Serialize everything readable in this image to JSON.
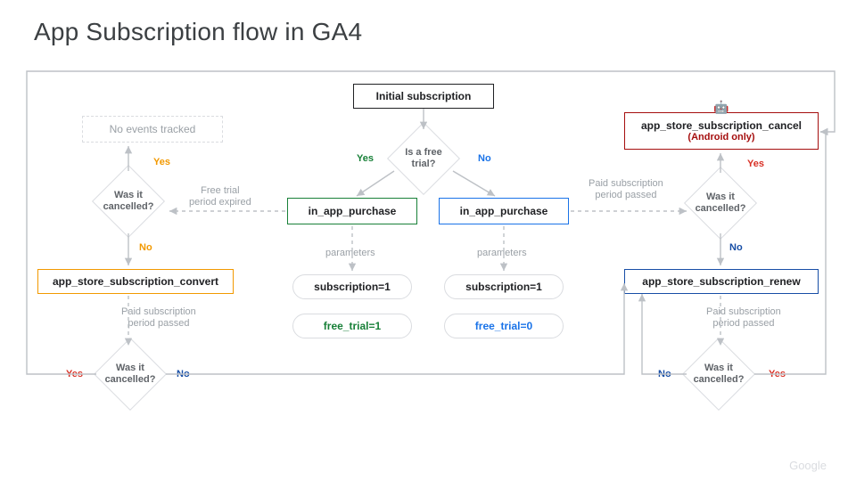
{
  "title": "App Subscription flow in GA4",
  "nodes": {
    "initial": "Initial subscription",
    "isFreeTrial": "Is a free\ntrial?",
    "inAppYes": "in_app_purchase",
    "inAppNo": "in_app_purchase",
    "paramsYes": "parameters",
    "paramsNo": "parameters",
    "subEq1a": "subscription=1",
    "subEq1b": "subscription=1",
    "freeTrial1": "free_trial=1",
    "freeTrial0": "free_trial=0",
    "noEvents": "No events tracked",
    "wasCancelled1": "Was it\ncancelled?",
    "wasCancelled2": "Was it\ncancelled?",
    "wasCancelled3": "Was it\ncancelled?",
    "wasCancelled4": "Was it\ncancelled?",
    "convert": "app_store_subscription_convert",
    "renew": "app_store_subscription_renew",
    "cancel": "app_store_subscription_cancel",
    "cancelSub": "(Android only)"
  },
  "edges": {
    "yes": "Yes",
    "no": "No",
    "freeTrialExpired": "Free trial\nperiod expired",
    "paidSubPassed": "Paid subscription\nperiod passed"
  },
  "footer": "Google",
  "colors": {
    "black": "#202124",
    "gray": "#dadce0",
    "grayText": "#9aa0a6",
    "green": "#188038",
    "blue": "#1a73e8",
    "yellow": "#f29900",
    "red": "#d93025",
    "darkred": "#a50e0e",
    "navy": "#174ea6"
  }
}
